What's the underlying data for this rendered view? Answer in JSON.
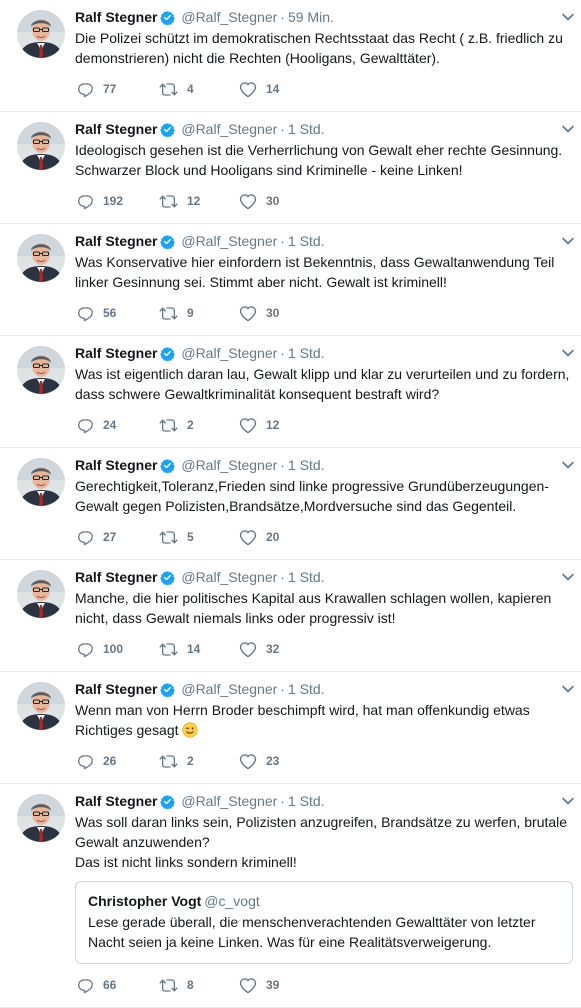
{
  "colors": {
    "name": "#14171a",
    "meta": "#657786",
    "verified": "#1da1f2",
    "divider": "#e6ecf0"
  },
  "tweets": [
    {
      "name": "Ralf Stegner",
      "handle": "@Ralf_Stegner",
      "time": "59 Min.",
      "text": "Die Polizei schützt im demokratischen Rechtsstaat das Recht ( z.B. friedlich zu demonstrieren) nicht die Rechten (Hooligans, Gewalttäter).",
      "replies": "77",
      "retweets": "4",
      "likes": "14"
    },
    {
      "name": "Ralf Stegner",
      "handle": "@Ralf_Stegner",
      "time": "1 Std.",
      "text": "Ideologisch gesehen ist die Verherrlichung von Gewalt eher rechte Gesinnung. Schwarzer Block und Hooligans sind Kriminelle - keine Linken!",
      "replies": "192",
      "retweets": "12",
      "likes": "30"
    },
    {
      "name": "Ralf Stegner",
      "handle": "@Ralf_Stegner",
      "time": "1 Std.",
      "text": "Was Konservative hier einfordern ist Bekenntnis, dass Gewaltanwendung Teil linker Gesinnung sei. Stimmt aber nicht. Gewalt ist kriminell!",
      "replies": "56",
      "retweets": "9",
      "likes": "30"
    },
    {
      "name": "Ralf Stegner",
      "handle": "@Ralf_Stegner",
      "time": "1 Std.",
      "text": "Was ist eigentlich daran lau, Gewalt klipp und klar zu verurteilen und zu fordern, dass schwere Gewaltkriminalität konsequent bestraft wird?",
      "replies": "24",
      "retweets": "2",
      "likes": "12"
    },
    {
      "name": "Ralf Stegner",
      "handle": "@Ralf_Stegner",
      "time": "1 Std.",
      "text": "Gerechtigkeit,Toleranz,Frieden sind linke progressive Grundüberzeugungen- Gewalt gegen Polizisten,Brandsätze,Mordversuche sind das Gegenteil.",
      "replies": "27",
      "retweets": "5",
      "likes": "20"
    },
    {
      "name": "Ralf Stegner",
      "handle": "@Ralf_Stegner",
      "time": "1 Std.",
      "text": "Manche, die hier politisches Kapital aus Krawallen schlagen wollen, kapieren nicht, dass Gewalt niemals links oder progressiv ist!",
      "replies": "100",
      "retweets": "14",
      "likes": "32"
    },
    {
      "name": "Ralf Stegner",
      "handle": "@Ralf_Stegner",
      "time": "1 Std.",
      "text": "Wenn man von Herrn Broder beschimpft wird, hat man offenkundig etwas Richtiges gesagt",
      "emoji": "winking-face-emoji",
      "replies": "26",
      "retweets": "2",
      "likes": "23"
    },
    {
      "name": "Ralf Stegner",
      "handle": "@Ralf_Stegner",
      "time": "1 Std.",
      "text": "Was soll daran links sein, Polizisten anzugreifen, Brandsätze zu werfen, brutale Gewalt anzuwenden?\nDas ist nicht links sondern kriminell!",
      "quote": {
        "name": "Christopher Vogt",
        "handle": "@c_vogt",
        "text": "Lese gerade überall, die menschenverachtenden Gewalttäter von letzter Nacht seien ja keine Linken. Was für eine Realitätsverweigerung."
      },
      "replies": "66",
      "retweets": "8",
      "likes": "39"
    }
  ],
  "icons": {
    "verified": "verified-badge-icon",
    "caret": "chevron-down-icon",
    "reply": "reply-icon",
    "retweet": "retweet-icon",
    "like": "heart-icon"
  }
}
